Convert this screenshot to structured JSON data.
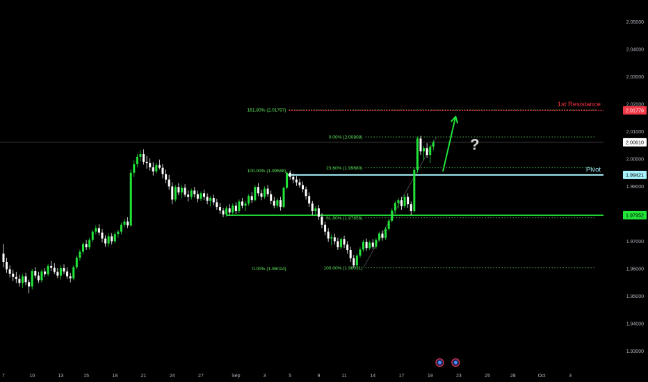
{
  "chart_data": {
    "type": "candlestick",
    "title": "",
    "xlabel": "",
    "ylabel": "",
    "ylim": [
      1.925,
      2.0565
    ],
    "x_ticks": [
      {
        "label": "7",
        "bar": 0
      },
      {
        "label": "10",
        "bar": 9
      },
      {
        "label": "13",
        "bar": 18
      },
      {
        "label": "15",
        "bar": 26
      },
      {
        "label": "18",
        "bar": 35
      },
      {
        "label": "21",
        "bar": 44
      },
      {
        "label": "24",
        "bar": 53
      },
      {
        "label": "27",
        "bar": 62
      },
      {
        "label": "Sep",
        "bar": 73
      },
      {
        "label": "3",
        "bar": 82
      },
      {
        "label": "5",
        "bar": 90
      },
      {
        "label": "9",
        "bar": 99
      },
      {
        "label": "11",
        "bar": 107
      },
      {
        "label": "14",
        "bar": 116
      },
      {
        "label": "17",
        "bar": 125
      },
      {
        "label": "19",
        "bar": 134
      },
      {
        "label": "23",
        "bar": 143
      },
      {
        "label": "25",
        "bar": 152
      },
      {
        "label": "28",
        "bar": 160
      },
      {
        "label": "Oct",
        "bar": 169
      },
      {
        "label": "3",
        "bar": 178
      }
    ],
    "y_ticks": [
      "2.05000",
      "2.04000",
      "2.03000",
      "2.02000",
      "2.01000",
      "2.00000",
      "1.99000",
      "1.98000",
      "1.97000",
      "1.96000",
      "1.95000",
      "1.94000",
      "1.93000"
    ],
    "y_tick_values": [
      2.05,
      2.04,
      2.03,
      2.02,
      2.01,
      2.0,
      1.99,
      1.98,
      1.97,
      1.96,
      1.95,
      1.94,
      1.93
    ],
    "last_price": {
      "value": 2.0061,
      "label": "2.00610"
    },
    "bullish_color": "#22e53a",
    "bearish_color": "#ffffff",
    "accent_red": "#f23645",
    "accent_cyan": "#a7f3fb",
    "accent_green": "#22e53a",
    "fib_color": "#5ee85e",
    "levels": [
      {
        "name": "1st Resistance",
        "value": 2.01776,
        "label": "2.01776",
        "color": "#f23645",
        "from_bar": 89
      },
      {
        "name": "Pivot",
        "value": 1.99421,
        "label": "1.99421",
        "color": "#a7f3fb",
        "from_bar": 89
      },
      {
        "name": "",
        "value": 1.97952,
        "label": "1.97952",
        "color": "#22e53a",
        "from_bar": 70
      }
    ],
    "fib_labels": [
      {
        "text": "161.80% (2.01797)",
        "value": 2.01797,
        "bar": 89,
        "anchor": "end",
        "line_to_bar": 186
      },
      {
        "text": "0.00% (2.00808)",
        "value": 2.00808,
        "bar": 113,
        "anchor": "end",
        "line_to_bar": 186
      },
      {
        "text": "100.00% (1.99588)",
        "value": 1.99588,
        "bar": 89,
        "anchor": "end",
        "line_to_bar": 89
      },
      {
        "text": "23.60% (1.99680)",
        "value": 1.9968,
        "bar": 113,
        "anchor": "end",
        "line_to_bar": 186
      },
      {
        "text": "61.80% (1.97856)",
        "value": 1.97856,
        "bar": 113,
        "anchor": "end",
        "line_to_bar": 186
      },
      {
        "text": "0.00% (1.96014)",
        "value": 1.96014,
        "bar": 89,
        "anchor": "end",
        "line_to_bar": 89
      },
      {
        "text": "100.00% (1.96031)",
        "value": 1.96031,
        "bar": 113,
        "anchor": "end",
        "line_to_bar": 186
      }
    ],
    "projection": {
      "from_bar": 138,
      "from_value": 1.9955,
      "to_bar": 142,
      "to_value": 2.0155
    },
    "question_mark": {
      "text": "?",
      "bar": 148,
      "value": 2.0055
    },
    "event_markers": [
      {
        "bar": 137
      },
      {
        "bar": 142
      }
    ],
    "candles": [
      [
        1.9655,
        1.969,
        1.9605,
        1.9625
      ],
      [
        1.9625,
        1.964,
        1.9585,
        1.9598
      ],
      [
        1.9598,
        1.9612,
        1.9568,
        1.9582
      ],
      [
        1.9582,
        1.9596,
        1.9555,
        1.957
      ],
      [
        1.957,
        1.9588,
        1.9548,
        1.9562
      ],
      [
        1.9562,
        1.9578,
        1.9535,
        1.9548
      ],
      [
        1.9548,
        1.958,
        1.953,
        1.9572
      ],
      [
        1.9572,
        1.9585,
        1.954,
        1.9551
      ],
      [
        1.9551,
        1.956,
        1.951,
        1.9535
      ],
      [
        1.9535,
        1.96,
        1.9525,
        1.9592
      ],
      [
        1.9592,
        1.9606,
        1.9565,
        1.9575
      ],
      [
        1.9575,
        1.9588,
        1.9548,
        1.9558
      ],
      [
        1.9558,
        1.9598,
        1.955,
        1.959
      ],
      [
        1.959,
        1.9602,
        1.957,
        1.958
      ],
      [
        1.958,
        1.9618,
        1.9572,
        1.961
      ],
      [
        1.961,
        1.9628,
        1.9592,
        1.9603
      ],
      [
        1.9603,
        1.962,
        1.958,
        1.9588
      ],
      [
        1.9588,
        1.9602,
        1.9565,
        1.9575
      ],
      [
        1.9575,
        1.9612,
        1.956,
        1.9602
      ],
      [
        1.9602,
        1.9616,
        1.958,
        1.959
      ],
      [
        1.959,
        1.9604,
        1.9562,
        1.9572
      ],
      [
        1.9572,
        1.9585,
        1.955,
        1.9565
      ],
      [
        1.9565,
        1.9612,
        1.9558,
        1.9605
      ],
      [
        1.9605,
        1.9648,
        1.9598,
        1.964
      ],
      [
        1.964,
        1.967,
        1.9628,
        1.9662
      ],
      [
        1.9662,
        1.9698,
        1.9652,
        1.969
      ],
      [
        1.969,
        1.9705,
        1.9668,
        1.9678
      ],
      [
        1.9678,
        1.9712,
        1.967,
        1.9705
      ],
      [
        1.9705,
        1.9742,
        1.9696,
        1.9735
      ],
      [
        1.9735,
        1.9758,
        1.9725,
        1.9748
      ],
      [
        1.9748,
        1.9762,
        1.9722,
        1.9732
      ],
      [
        1.9732,
        1.9745,
        1.9696,
        1.971
      ],
      [
        1.971,
        1.9722,
        1.968,
        1.9692
      ],
      [
        1.9692,
        1.9728,
        1.968,
        1.9718
      ],
      [
        1.9718,
        1.973,
        1.9688,
        1.97
      ],
      [
        1.97,
        1.9735,
        1.9692,
        1.9726
      ],
      [
        1.9726,
        1.9742,
        1.9712,
        1.9735
      ],
      [
        1.9735,
        1.9768,
        1.9725,
        1.976
      ],
      [
        1.976,
        1.9782,
        1.975,
        1.9772
      ],
      [
        1.9772,
        1.9788,
        1.9748,
        1.9758
      ],
      [
        1.9758,
        1.9962,
        1.9752,
        1.995
      ],
      [
        1.995,
        1.9995,
        1.9935,
        1.9982
      ],
      [
        1.9982,
        2.0018,
        1.997,
        2.0008
      ],
      [
        2.0008,
        2.0032,
        1.9992,
        2.0018
      ],
      [
        2.0018,
        2.0035,
        1.998,
        1.999
      ],
      [
        1.999,
        2.0012,
        1.9965,
        1.9985
      ],
      [
        1.9985,
        2.0002,
        1.9958,
        1.997
      ],
      [
        1.997,
        1.9988,
        1.994,
        1.9955
      ],
      [
        1.9955,
        1.9985,
        1.9948,
        1.9978
      ],
      [
        1.9978,
        1.9998,
        1.9962,
        1.9968
      ],
      [
        1.9968,
        1.9982,
        1.993,
        1.9945
      ],
      [
        1.9945,
        1.9962,
        1.9912,
        1.9925
      ],
      [
        1.9925,
        1.9942,
        1.9888,
        1.99
      ],
      [
        1.99,
        1.9915,
        1.9835,
        1.9852
      ],
      [
        1.9852,
        1.9905,
        1.9845,
        1.9898
      ],
      [
        1.9898,
        1.9912,
        1.9868,
        1.9878
      ],
      [
        1.9878,
        1.9905,
        1.9858,
        1.9895
      ],
      [
        1.9895,
        1.9908,
        1.9862,
        1.987
      ],
      [
        1.987,
        1.9885,
        1.9845,
        1.9862
      ],
      [
        1.9862,
        1.9892,
        1.9852,
        1.9885
      ],
      [
        1.9885,
        1.9898,
        1.986,
        1.9872
      ],
      [
        1.9872,
        1.9885,
        1.9842,
        1.9855
      ],
      [
        1.9855,
        1.9882,
        1.9848,
        1.9875
      ],
      [
        1.9875,
        1.9888,
        1.985,
        1.9862
      ],
      [
        1.9862,
        1.9875,
        1.9835,
        1.9848
      ],
      [
        1.9848,
        1.9865,
        1.9828,
        1.9858
      ],
      [
        1.9858,
        1.987,
        1.9832,
        1.9842
      ],
      [
        1.9842,
        1.9855,
        1.9815,
        1.9825
      ],
      [
        1.9825,
        1.984,
        1.98,
        1.9812
      ],
      [
        1.9812,
        1.9822,
        1.9788,
        1.9798
      ],
      [
        1.9798,
        1.9828,
        1.979,
        1.982
      ],
      [
        1.982,
        1.9835,
        1.9795,
        1.9805
      ],
      [
        1.9805,
        1.9838,
        1.9798,
        1.983
      ],
      [
        1.983,
        1.9842,
        1.98,
        1.981
      ],
      [
        1.981,
        1.9852,
        1.9802,
        1.9845
      ],
      [
        1.9845,
        1.9858,
        1.982,
        1.983
      ],
      [
        1.983,
        1.9848,
        1.981,
        1.9838
      ],
      [
        1.9838,
        1.9872,
        1.983,
        1.9865
      ],
      [
        1.9865,
        1.988,
        1.984,
        1.985
      ],
      [
        1.985,
        1.9905,
        1.9845,
        1.9898
      ],
      [
        1.9898,
        1.9912,
        1.9865,
        1.9875
      ],
      [
        1.9875,
        1.9888,
        1.985,
        1.9862
      ],
      [
        1.9862,
        1.99,
        1.9855,
        1.9892
      ],
      [
        1.9892,
        1.9905,
        1.9862,
        1.9872
      ],
      [
        1.9872,
        1.9885,
        1.9835,
        1.9848
      ],
      [
        1.9848,
        1.9862,
        1.982,
        1.983
      ],
      [
        1.983,
        1.9858,
        1.9822,
        1.985
      ],
      [
        1.985,
        1.9862,
        1.9812,
        1.9825
      ],
      [
        1.9825,
        1.99,
        1.982,
        1.9895
      ],
      [
        1.9895,
        1.9955,
        1.989,
        1.995
      ],
      [
        1.995,
        1.9958,
        1.9925,
        1.9935
      ],
      [
        1.9935,
        1.9948,
        1.9912,
        1.9925
      ],
      [
        1.9925,
        1.9938,
        1.9902,
        1.9915
      ],
      [
        1.9915,
        1.9928,
        1.9895,
        1.9905
      ],
      [
        1.9905,
        1.9918,
        1.9878,
        1.989
      ],
      [
        1.989,
        1.99,
        1.9852,
        1.9865
      ],
      [
        1.9865,
        1.9878,
        1.9825,
        1.9838
      ],
      [
        1.9838,
        1.9848,
        1.9795,
        1.981
      ],
      [
        1.981,
        1.9828,
        1.9798,
        1.982
      ],
      [
        1.982,
        1.9832,
        1.9778,
        1.979
      ],
      [
        1.979,
        1.9802,
        1.9748,
        1.976
      ],
      [
        1.976,
        1.9772,
        1.9722,
        1.9735
      ],
      [
        1.9735,
        1.9748,
        1.9698,
        1.971
      ],
      [
        1.971,
        1.9725,
        1.9685,
        1.9715
      ],
      [
        1.9715,
        1.9728,
        1.9688,
        1.97
      ],
      [
        1.97,
        1.9712,
        1.9668,
        1.9678
      ],
      [
        1.9678,
        1.9715,
        1.967,
        1.9708
      ],
      [
        1.9708,
        1.972,
        1.9675,
        1.9688
      ],
      [
        1.9688,
        1.97,
        1.9655,
        1.9668
      ],
      [
        1.9668,
        1.968,
        1.9625,
        1.9638
      ],
      [
        1.9638,
        1.965,
        1.9603,
        1.9612
      ],
      [
        1.9612,
        1.9655,
        1.9605,
        1.9648
      ],
      [
        1.9648,
        1.9678,
        1.964,
        1.967
      ],
      [
        1.967,
        1.9705,
        1.9662,
        1.9698
      ],
      [
        1.9698,
        1.971,
        1.9665,
        1.9675
      ],
      [
        1.9675,
        1.9702,
        1.9668,
        1.9695
      ],
      [
        1.9695,
        1.9708,
        1.9672,
        1.968
      ],
      [
        1.968,
        1.9712,
        1.9672,
        1.9705
      ],
      [
        1.9705,
        1.9735,
        1.9698,
        1.9728
      ],
      [
        1.9728,
        1.974,
        1.9702,
        1.9712
      ],
      [
        1.9712,
        1.9752,
        1.9705,
        1.9745
      ],
      [
        1.9745,
        1.9782,
        1.9738,
        1.9775
      ],
      [
        1.9775,
        1.982,
        1.9768,
        1.9812
      ],
      [
        1.9812,
        1.9848,
        1.98,
        1.984
      ],
      [
        1.984,
        1.9858,
        1.982,
        1.985
      ],
      [
        1.985,
        1.9862,
        1.9815,
        1.9828
      ],
      [
        1.9828,
        1.987,
        1.982,
        1.9862
      ],
      [
        1.9862,
        1.9875,
        1.9822,
        1.9835
      ],
      [
        1.9835,
        1.9845,
        1.9795,
        1.981
      ],
      [
        1.981,
        1.9968,
        1.9805,
        1.996
      ],
      [
        1.996,
        2.0082,
        1.995,
        2.0075
      ],
      [
        2.0075,
        2.0085,
        2.0015,
        2.0028
      ],
      [
        2.0028,
        2.0048,
        1.9995,
        2.004
      ],
      [
        2.004,
        2.0058,
        2.0005,
        2.0015
      ],
      [
        2.0015,
        2.0052,
        1.9985,
        2.0045
      ],
      [
        2.0045,
        2.0068,
        2.0032,
        2.0061
      ]
    ]
  }
}
